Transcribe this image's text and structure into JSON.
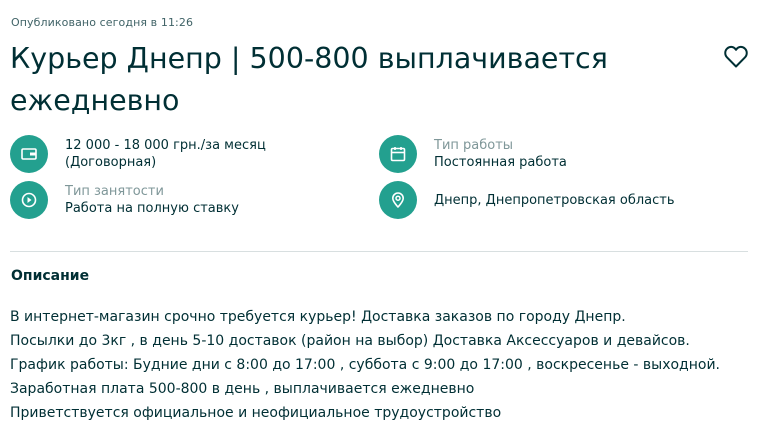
{
  "header": {
    "published": "Опубликовано сегодня в 11:26",
    "title": "Курьер Днепр | 500-800 выплачивается ежедневно"
  },
  "details": {
    "salary": {
      "icon": "wallet-icon",
      "line1": "12 000 - 18 000 грн./за месяц",
      "line2": "(Договорная)"
    },
    "work_type": {
      "icon": "calendar-icon",
      "label": "Тип работы",
      "value": "Постоянная работа"
    },
    "employment": {
      "icon": "clock-icon",
      "label": "Тип занятости",
      "value": "Работа на полную ставку"
    },
    "location": {
      "icon": "location-pin-icon",
      "value": "Днепр, Днепропетровская область"
    }
  },
  "description": {
    "heading": "Описание",
    "lines": [
      "В интернет-магазин срочно требуется курьер! Доставка заказов по городу Днепр.",
      "Посылки до 3кг , в день 5-10 доставок (район на выбор) Доставка Аксессуаров и девайсов.",
      "График работы: Будние дни с  8:00 до 17:00 , суббота с 9:00 до 17:00 , воскресенье - выходной.",
      "Заработная плата 500-800 в день , выплачивается ежедневно",
      "Приветствуется официальное и неофициальное трудоустройство"
    ]
  },
  "colors": {
    "accent": "#23a08f",
    "text": "#002f34",
    "muted": "#7f9799"
  }
}
